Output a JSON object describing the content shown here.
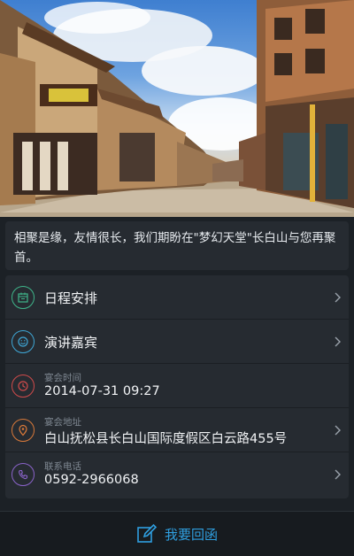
{
  "intro": {
    "text": "相聚是缘，友情很长，我们期盼在\"梦幻天堂\"长白山与您再聚首。"
  },
  "items": [
    {
      "title": "日程安排",
      "icon": "calendar-icon",
      "color": "#3fb58a"
    },
    {
      "title": "演讲嘉宾",
      "icon": "smile-icon",
      "color": "#3fa7d6"
    },
    {
      "label": "宴会时间",
      "value": "2014-07-31 09:27",
      "icon": "clock-icon",
      "color": "#d04b4b"
    },
    {
      "label": "宴会地址",
      "value": "白山抚松县长白山国际度假区白云路455号",
      "icon": "location-pin-icon",
      "color": "#d9793a"
    },
    {
      "label": "联系电话",
      "value": "0592-2966068",
      "icon": "phone-icon",
      "color": "#8a63c9"
    }
  ],
  "bottom_bar": {
    "reply_label": "我要回函",
    "accent": "#2f9fe0"
  }
}
